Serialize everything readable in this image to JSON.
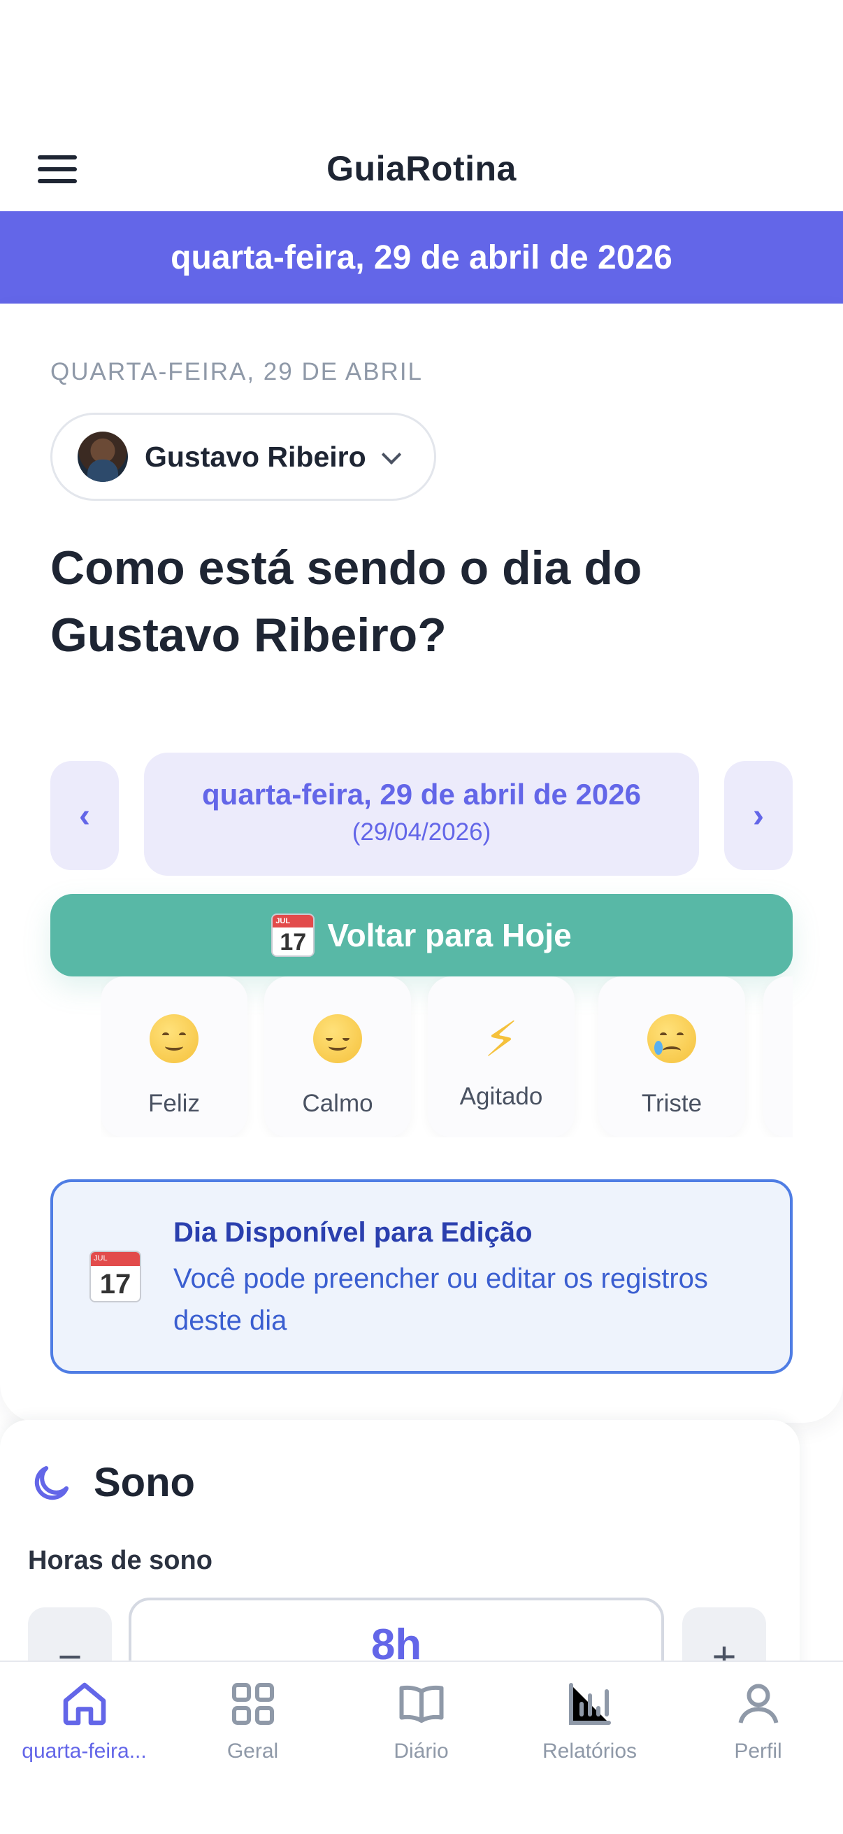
{
  "app": {
    "title": "GuiaRotina"
  },
  "banner": {
    "date": "quarta-feira, 29 de abril de 2026"
  },
  "header": {
    "eyebrow": "QUARTA-FEIRA, 29 DE ABRIL",
    "child_name": "Gustavo Ribeiro",
    "question": "Como está sendo o dia do Gustavo Ribeiro?"
  },
  "date_nav": {
    "prev": "‹",
    "next": "›",
    "long_date": "quarta-feira, 29 de abril de 2026",
    "short_date": "(29/04/2026)",
    "today_button": "Voltar para Hoje",
    "calendar_month": "JUL",
    "calendar_day": "17"
  },
  "moods": [
    {
      "label": "Feliz",
      "icon": "happy-face-icon"
    },
    {
      "label": "Calmo",
      "icon": "relieved-face-icon"
    },
    {
      "label": "Agitado",
      "icon": "lightning-icon"
    },
    {
      "label": "Triste",
      "icon": "crying-face-icon"
    }
  ],
  "notice": {
    "title": "Dia Disponível para Edição",
    "body": "Você pode preencher ou editar os registros deste dia"
  },
  "sleep": {
    "title": "Sono",
    "hours_label": "Horas de sono",
    "hours_value": "8h",
    "minus": "−",
    "plus": "+"
  },
  "bottom_nav": [
    {
      "label": "quarta-feira...",
      "icon": "home-icon",
      "active": true
    },
    {
      "label": "Geral",
      "icon": "grid-icon",
      "active": false
    },
    {
      "label": "Diário",
      "icon": "book-icon",
      "active": false
    },
    {
      "label": "Relatórios",
      "icon": "bar-chart-icon",
      "active": false
    },
    {
      "label": "Perfil",
      "icon": "user-icon",
      "active": false
    }
  ],
  "colors": {
    "accent": "#6366e8",
    "teal": "#58b8a6",
    "notice_border": "#4f7de4",
    "text": "#1e2533"
  }
}
